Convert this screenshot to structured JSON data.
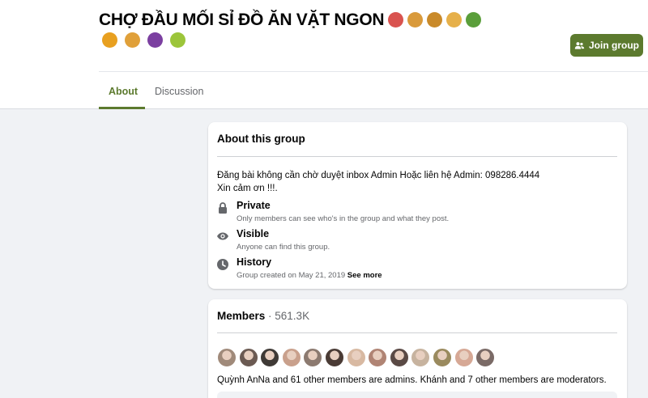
{
  "group": {
    "title": "CHỢ ĐẦU MỐI SỈ ĐỒ ĂN VẶT NGON",
    "title_emojis": [
      {
        "icon": "bacon-emoji",
        "color": "#d9534f"
      },
      {
        "icon": "pretzel-emoji",
        "color": "#d99a3b"
      },
      {
        "icon": "taco-emoji",
        "color": "#c98a2a"
      },
      {
        "icon": "spaghetti-emoji",
        "color": "#e6b04a"
      },
      {
        "icon": "salad-emoji",
        "color": "#5a9e3a"
      }
    ],
    "title_emojis_row2": [
      {
        "icon": "french-fries-emoji",
        "color": "#e8a020"
      },
      {
        "icon": "pizza-emoji",
        "color": "#e0a03a"
      },
      {
        "icon": "grapes-emoji",
        "color": "#7b3fa0"
      },
      {
        "icon": "pear-emoji",
        "color": "#9cc53a"
      }
    ],
    "join_label": "Join group"
  },
  "tabs": [
    {
      "label": "About",
      "active": true
    },
    {
      "label": "Discussion",
      "active": false
    }
  ],
  "about": {
    "title": "About this group",
    "description_line1": "Đăng bài không cần chờ duyệt inbox Admin Hoặc liên hệ Admin: 098286.4444",
    "description_line2": "Xin cảm ơn !!!.",
    "items": [
      {
        "icon": "lock-icon",
        "label": "Private",
        "sub": "Only members can see who's in the group and what they post."
      },
      {
        "icon": "eye-icon",
        "label": "Visible",
        "sub": "Anyone can find this group."
      },
      {
        "icon": "clock-icon",
        "label": "History",
        "sub": "Group created on May 21, 2019",
        "more": "See more"
      }
    ]
  },
  "members": {
    "title": "Members",
    "count": "561.3K",
    "avatar_colors": [
      "#a08a7a",
      "#6b5a52",
      "#3f3a36",
      "#c9a08c",
      "#8c7a70",
      "#4a3b35",
      "#d8b9a2",
      "#b08474",
      "#5a4a45",
      "#c7b39f",
      "#9a8a5e",
      "#d6a895",
      "#7a6a66"
    ],
    "admins_text": "Quỳnh AnNa and 61 other members are admins. Khánh and 7 other members are moderators."
  },
  "colors": {
    "accent": "#5c7a2e",
    "background": "#f0f2f5",
    "secondary_text": "#65676b"
  }
}
